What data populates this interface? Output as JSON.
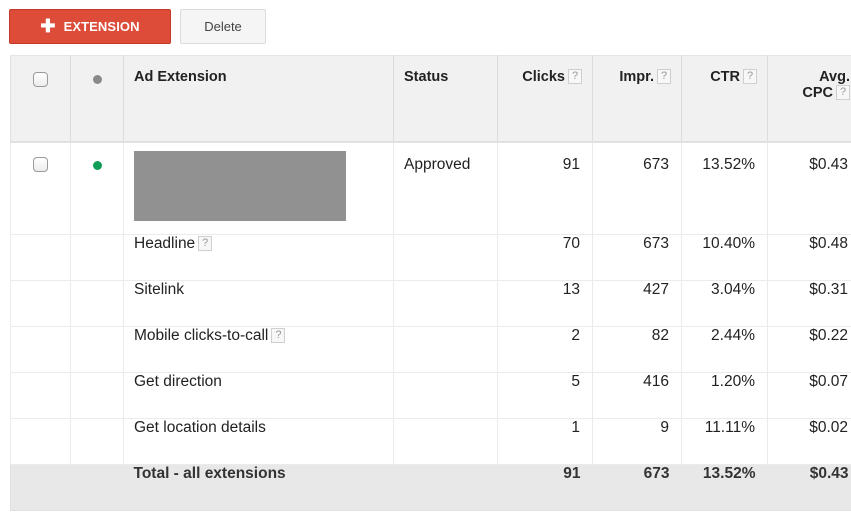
{
  "toolbar": {
    "add_label": "EXTENSION",
    "add_icon": "plus-icon",
    "delete_label": "Delete"
  },
  "colors": {
    "add_button": "#dd4b39",
    "status_enabled_dot": "#0f9d58",
    "header_dot": "#8a8a8a",
    "total_row_bg": "#e8e8e8"
  },
  "table": {
    "columns": {
      "ad_extension": "Ad Extension",
      "status": "Status",
      "clicks": "Clicks",
      "impr": "Impr.",
      "ctr": "CTR",
      "avg_cpc_line1": "Avg.",
      "avg_cpc_line2": "CPC",
      "help": "?"
    },
    "main_row": {
      "status": "Approved",
      "clicks": "91",
      "impr": "673",
      "ctr": "13.52%",
      "avg_cpc": "$0.43"
    },
    "rows": [
      {
        "name": "Headline",
        "has_help": true,
        "clicks": "70",
        "impr": "673",
        "ctr": "10.40%",
        "avg_cpc": "$0.48"
      },
      {
        "name": "Sitelink",
        "has_help": false,
        "clicks": "13",
        "impr": "427",
        "ctr": "3.04%",
        "avg_cpc": "$0.31"
      },
      {
        "name": "Mobile clicks-to-call",
        "has_help": true,
        "clicks": "2",
        "impr": "82",
        "ctr": "2.44%",
        "avg_cpc": "$0.22"
      },
      {
        "name": "Get direction",
        "has_help": false,
        "clicks": "5",
        "impr": "416",
        "ctr": "1.20%",
        "avg_cpc": "$0.07"
      },
      {
        "name": "Get location details",
        "has_help": false,
        "clicks": "1",
        "impr": "9",
        "ctr": "11.11%",
        "avg_cpc": "$0.02"
      }
    ],
    "total": {
      "label": "Total - all extensions",
      "clicks": "91",
      "impr": "673",
      "ctr": "13.52%",
      "avg_cpc": "$0.43"
    }
  }
}
